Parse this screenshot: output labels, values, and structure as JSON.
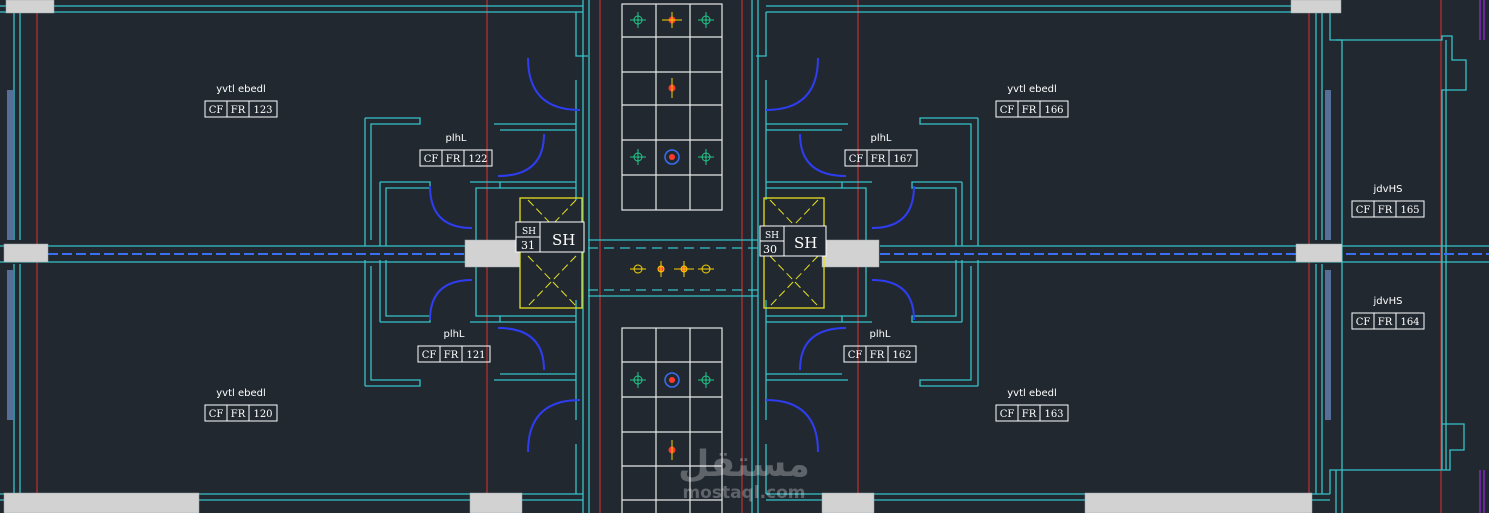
{
  "colors": {
    "background": "#212830",
    "wall": "#35c2c8",
    "grid": "#e03030",
    "door": "#2f3df0",
    "window_fill": "#d2d2d2",
    "tag": "#ffffff",
    "shaft": "#e6e21e",
    "centerline": "#3a6ff2"
  },
  "rooms": [
    {
      "name": "yvtl  ebedl",
      "tag": [
        "CF",
        "FR",
        "123"
      ]
    },
    {
      "name": "plhL",
      "tag": [
        "CF",
        "FR",
        "122"
      ]
    },
    {
      "name": "plhL",
      "tag": [
        "CF",
        "FR",
        "121"
      ]
    },
    {
      "name": "yvtl  ebedl",
      "tag": [
        "CF",
        "FR",
        "120"
      ]
    },
    {
      "name": "yvtl  ebedl",
      "tag": [
        "CF",
        "FR",
        "166"
      ]
    },
    {
      "name": "plhL",
      "tag": [
        "CF",
        "FR",
        "167"
      ]
    },
    {
      "name": "jdvHS",
      "tag": [
        "CF",
        "FR",
        "165"
      ]
    },
    {
      "name": "jdvHS",
      "tag": [
        "CF",
        "FR",
        "164"
      ]
    },
    {
      "name": "plhL",
      "tag": [
        "CF",
        "FR",
        "162"
      ]
    },
    {
      "name": "yvtl  ebedl",
      "tag": [
        "CF",
        "FR",
        "163"
      ]
    }
  ],
  "shafts": [
    {
      "small_label": "SH",
      "number": "31",
      "label": "SH"
    },
    {
      "small_label": "SH",
      "number": "30",
      "label": "SH"
    }
  ],
  "watermark": {
    "arabic": "مستقل",
    "latin": "mostaql.com"
  }
}
